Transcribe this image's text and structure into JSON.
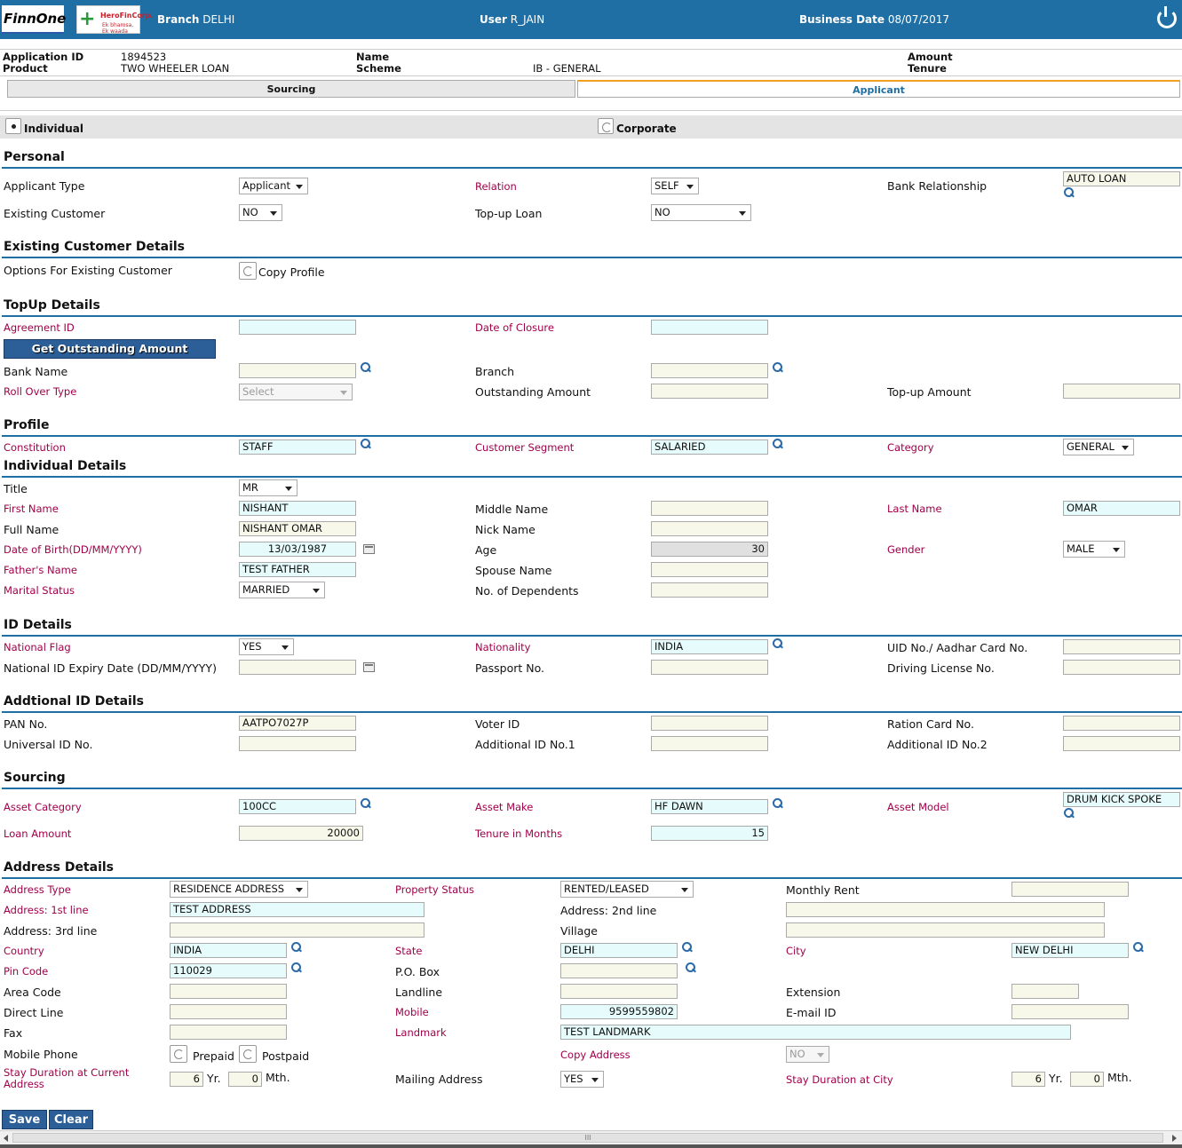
{
  "header": {
    "logo_finnone": "FinnOne",
    "logo_hero": "HeroFinCorp.",
    "logo_hero_sub": "Ek bharosa, Ek waada",
    "branch_label": "Branch",
    "branch": "DELHI",
    "user_label": "User",
    "user": "R_JAIN",
    "bdate_label": "Business Date",
    "bdate": "08/07/2017"
  },
  "info": {
    "app_id_label": "Application ID",
    "app_id": "1894523",
    "product_label": "Product",
    "product": "TWO WHEELER LOAN",
    "name_label": "Name",
    "scheme_label": "Scheme",
    "scheme": "IB - GENERAL",
    "amount_label": "Amount",
    "tenure_label": "Tenure"
  },
  "tabs": {
    "sourcing": "Sourcing",
    "applicant": "Applicant"
  },
  "type": {
    "individual": "Individual",
    "corporate": "Corporate"
  },
  "personal": {
    "title": "Personal",
    "applicant_type_label": "Applicant Type",
    "applicant_type": "Applicant",
    "relation_label": "Relation",
    "relation": "SELF",
    "bank_rel_label": "Bank Relationship",
    "bank_rel": "AUTO LOAN",
    "existing_label": "Existing Customer",
    "existing": "NO",
    "topup_label": "Top-up Loan",
    "topup": "NO"
  },
  "existing": {
    "title": "Existing Customer Details",
    "options_label": "Options For Existing Customer",
    "copy_profile": "Copy Profile"
  },
  "topup": {
    "title": "TopUp Details",
    "agreement_label": "Agreement ID",
    "closure_label": "Date of Closure",
    "get_btn": "Get Outstanding Amount",
    "bank_label": "Bank Name",
    "branch_label": "Branch",
    "rollover_label": "Roll Over Type",
    "rollover": "Select",
    "outstanding_label": "Outstanding Amount",
    "topup_amount_label": "Top-up Amount"
  },
  "profile": {
    "title": "Profile",
    "constitution_label": "Constitution",
    "constitution": "STAFF",
    "segment_label": "Customer Segment",
    "segment": "SALARIED",
    "category_label": "Category",
    "category": "GENERAL"
  },
  "individual": {
    "title": "Individual Details",
    "title_label": "Title",
    "title_val": "MR",
    "first_label": "First Name",
    "first": "NISHANT",
    "middle_label": "Middle Name",
    "last_label": "Last Name",
    "last": "OMAR",
    "full_label": "Full Name",
    "full": "NISHANT OMAR",
    "nick_label": "Nick Name",
    "dob_label": "Date of Birth(DD/MM/YYYY)",
    "dob": "13/03/1987",
    "age_label": "Age",
    "age": "30",
    "gender_label": "Gender",
    "gender": "MALE",
    "father_label": "Father's Name",
    "father": "TEST FATHER",
    "spouse_label": "Spouse Name",
    "marital_label": "Marital Status",
    "marital": "MARRIED",
    "dependents_label": "No. of Dependents"
  },
  "id": {
    "title": "ID Details",
    "flag_label": "National Flag",
    "flag": "YES",
    "nationality_label": "Nationality",
    "nationality": "INDIA",
    "uid_label": "UID No./ Aadhar Card No.",
    "expiry_label": "National ID Expiry Date (DD/MM/YYYY)",
    "passport_label": "Passport No.",
    "dl_label": "Driving License No."
  },
  "addl": {
    "title": "Addtional ID Details",
    "pan_label": "PAN No.",
    "pan": "AATPO7027P",
    "voter_label": "Voter ID",
    "ration_label": "Ration Card No.",
    "universal_label": "Universal ID No.",
    "add1_label": "Additional ID No.1",
    "add2_label": "Additional ID No.2"
  },
  "sourcing": {
    "title": "Sourcing",
    "asset_cat_label": "Asset Category",
    "asset_cat": "100CC",
    "asset_make_label": "Asset Make",
    "asset_make": "HF DAWN",
    "asset_model_label": "Asset Model",
    "asset_model": "DRUM KICK SPOKE",
    "loan_label": "Loan Amount",
    "loan": "20000",
    "tenure_label": "Tenure in Months",
    "tenure": "15"
  },
  "address": {
    "title": "Address Details",
    "type_label": "Address Type",
    "type": "RESIDENCE ADDRESS",
    "prop_label": "Property Status",
    "prop": "RENTED/LEASED",
    "rent_label": "Monthly Rent",
    "line1_label": "Address: 1st line",
    "line1": "TEST ADDRESS",
    "line2_label": "Address: 2nd line",
    "line3_label": "Address: 3rd line",
    "village_label": "Village",
    "country_label": "Country",
    "country": "INDIA",
    "state_label": "State",
    "state": "DELHI",
    "city_label": "City",
    "city": "NEW DELHI",
    "pin_label": "Pin Code",
    "pin": "110029",
    "po_label": "P.O. Box",
    "area_label": "Area Code",
    "landline_label": "Landline",
    "ext_label": "Extension",
    "direct_label": "Direct Line",
    "mobile_label": "Mobile",
    "mobile": "9599559802",
    "email_label": "E-mail ID",
    "fax_label": "Fax",
    "landmark_label": "Landmark",
    "landmark": "TEST LANDMARK",
    "mobphone_label": "Mobile Phone",
    "prepaid": "Prepaid",
    "postpaid": "Postpaid",
    "copy_label": "Copy Address",
    "copy": "NO",
    "stay_label": "Stay Duration at Current Address",
    "stay_yr": "6",
    "yr": "Yr.",
    "stay_mth": "0",
    "mth": "Mth.",
    "mailing_label": "Mailing Address",
    "mailing": "YES",
    "city_stay_label": "Stay Duration at City",
    "city_yr": "6",
    "city_mth": "0"
  },
  "actions": {
    "save": "Save",
    "clear": "Clear"
  },
  "scroll": {
    "grip": "III"
  }
}
